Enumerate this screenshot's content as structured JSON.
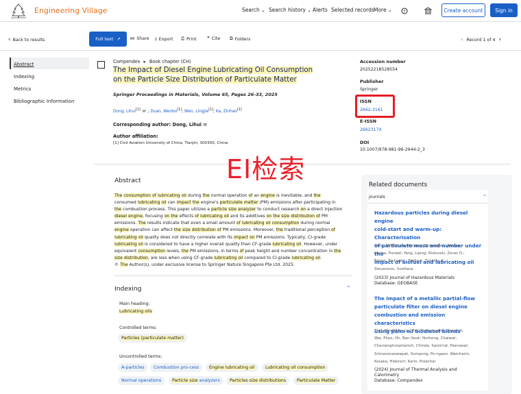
{
  "header": {
    "brand": "Engineering Village",
    "nav": [
      "Search",
      "Search history",
      "Alerts",
      "Selected records",
      "More"
    ],
    "create": "Create account",
    "signin": "Sign in"
  },
  "toolbar": {
    "back": "Back to results",
    "fulltext": "Full text",
    "share": "Share",
    "export": "Export",
    "print": "Print",
    "cite": "Cite",
    "folders": "Folders",
    "record": "Record 1 of 4"
  },
  "sidebar": {
    "items": [
      "Abstract",
      "Indexing",
      "Metrics",
      "Bibliographic Information"
    ]
  },
  "record": {
    "crumb1": "Compendex",
    "crumb2": "Book chapter (CH)",
    "title1": "The Impact of Diesel Engine Lubricating Oil Consumption",
    "title2": "on the Particle Size Distribution of Particulate Matter",
    "source": "Springer Proceedings in Materials, Volume 65, Pages 26-33, 2025",
    "authors": [
      {
        "name": "Dong, Lihui",
        "sup": "[1]"
      },
      {
        "name": "Duan, Wenbo",
        "sup": "[1]"
      },
      {
        "name": "Wen, Lingjie",
        "sup": "[1]"
      },
      {
        "name": "Ka, Zhihao",
        "sup": "[1]"
      }
    ],
    "corr_label": "Corresponding author:",
    "corr": "Dong, Lihui",
    "aff_label": "Author affiliation:",
    "aff": "[1] Civil Aviation University of China, Tianjin; 300300, China"
  },
  "overlay_text": "EI检索",
  "abstract": {
    "heading": "Abstract",
    "lines": [
      "The consumption of lubricating oil during the normal operation of an engine is inevitable, and the",
      "consumed lubricating oil can impact the engine's particulate matter (PM) emissions after participating in",
      "the combustion process. This paper utilizes a particle size analyzer to conduct research on a direct injection",
      "diesel engine, focusing on the effects of lubricating oil and its additives on the size distribution of PM",
      "emissions. The results indicate that even a small amount of lubricating oil consumption during normal",
      "engine operation can affect the size distribution of PM emissions. Moreover, the traditional perception of",
      "lubricating oil quality does not directly correlate with its impact on PM emissions. Typically, CI-grade",
      "lubricating oil is considered to have a higher overall quality than CF-grade lubricating oil. However, under",
      "equivalent consumption levels, the PM emissions, in terms of peak height and number concentration in the",
      "size distribution, are less when using CF-grade lubricating oil compared to CI-grade lubricating oil.",
      "© The Author(s), under exclusive license to Springer Nature Singapore Pte Ltd. 2025."
    ],
    "highlight_terms": [
      "consumption",
      "lubricating",
      "oil",
      "the",
      "engine",
      "impact",
      "particulate",
      "matter",
      "particle",
      "size",
      "analyzer",
      "on",
      "diesel",
      "distribution",
      "The",
      "of"
    ]
  },
  "indexing": {
    "heading": "Indexing",
    "main_label": "Main heading:",
    "main": "Lubricating oils",
    "ctrl_label": "Controlled terms:",
    "ctrl": "Particles (particulate matter)",
    "unctrl_label": "Uncontrolled terms:",
    "tags_row1": [
      "A-particles",
      "Combustion pro-cess",
      "Engine lubricating oil",
      "Lubricating oil consumption"
    ],
    "tags_row2": [
      "Normal operations",
      "Particle size analyzers",
      "Particles-size distributions",
      "Particulate Matter"
    ]
  },
  "meta": {
    "acc_label": "Accession number",
    "acc": "20252218528554",
    "pub_label": "Publisher",
    "pub": "Springer",
    "issn_label": "ISSN",
    "issn": "2662-3161",
    "eissn_label": "E-ISSN",
    "eissn": "2662317X",
    "doi_label": "DOI",
    "doi": "10.1007/978-981-96-2944-2_3"
  },
  "related": {
    "heading": "Related documents",
    "filter": "journals",
    "docs": [
      {
        "title": [
          "Hazardous particles during diesel engine",
          "cold-start and warm-up: Characterisation",
          "of particulate mass and number under the",
          "impact of biofuel and lubricating oil"
        ],
        "authors": [
          "Zare, Ali;  Babaie, Meisam;  Shirneshan, Alireza;",
          "Verma, Puneet;  Yang, Liping;  Ristovski, Zoran D.;",
          "Brown, Richard J.;  Bodisco, Timothy A.;",
          "Stevanovic, Svetlana"
        ],
        "year_journal": "(2023) Journal of Hazardous Materials",
        "database": "Database: GEOBASE"
      },
      {
        "title": [
          "The impact of a metallic partial-flow",
          "particulate filter on diesel engine",
          "combustion and emission characteristics",
          "using palm oil biodiesel blends"
        ],
        "authors": [
          "Thin, MyatMau;  Liu, Hai;  Thaevinyakul, Poonnut;",
          "Wai, Phyo;  Oh, Ban-Seok;  Nuthong, Chaiwat;",
          "Charoenphonphanich, Chinda;  Saisirirat, Peerawat;",
          "Srimanosaowapak, Sompong;  Po-ngaen, Watcharin;",
          "Kosaka, Hidenori;  Karin, Preechar"
        ],
        "year_journal": "(2024) Journal of Thermal Analysis and",
        "year_journal2": "Calorimetry",
        "database": "Database: Compendex"
      }
    ]
  }
}
